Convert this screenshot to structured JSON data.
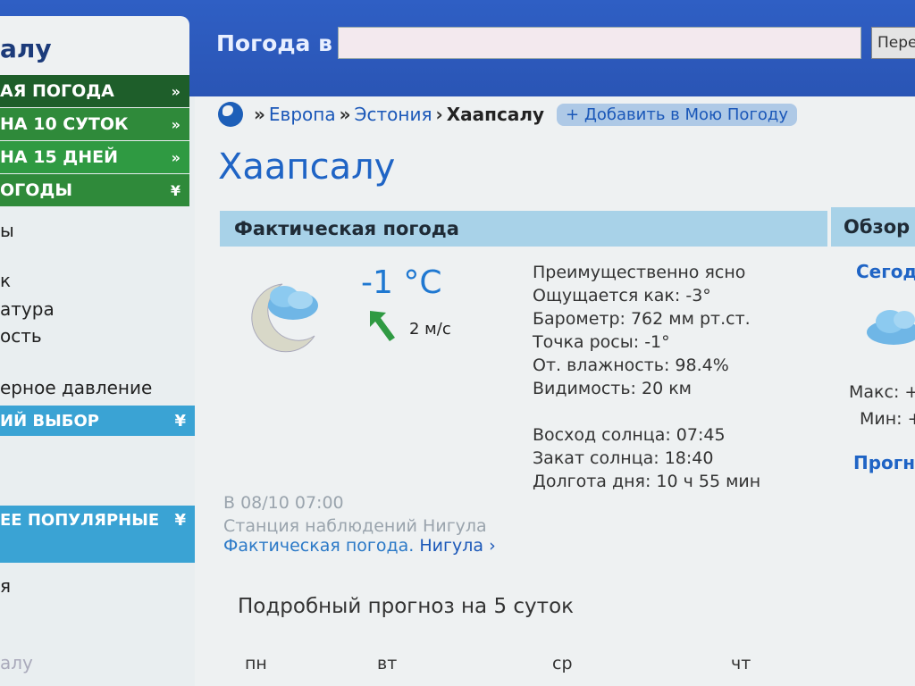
{
  "header": {
    "site_name": "алу",
    "search_label": "Погода в",
    "search_value": "",
    "search_button": "Пере"
  },
  "left_menu": {
    "green_items": [
      {
        "label": "АЯ ПОГОДА",
        "arrow": "»"
      },
      {
        "label": "НА 10 СУТОК",
        "arrow": "»"
      },
      {
        "label": "НА 15 ДНЕЙ",
        "arrow": "»"
      },
      {
        "label": "ОГОДЫ",
        "arrow": "¥"
      }
    ],
    "links": [
      "ы",
      "к",
      "атура",
      "ость",
      "ерное давление"
    ],
    "choice_bar": "ИЙ ВЫБОР",
    "popular_bar": "ЕЕ ПОПУЛЯРНЫЕ",
    "bottom_links": [
      "я",
      "алу"
    ]
  },
  "breadcrumb": {
    "europe": "Европа",
    "estonia": "Эстония",
    "current": "Хаапсалу",
    "sep1": "»",
    "sep2": "»",
    "sep3": "›",
    "lead": "»",
    "add_button": "+ Добавить в Мою Погоду"
  },
  "city_title": "Хаапсалу",
  "current": {
    "section_title": "Фактическая погода",
    "temperature": "-1 °C",
    "wind": "2 м/с",
    "details": [
      "Преимущественно ясно",
      "Ощущается как: -3°",
      "Барометр: 762 мм рт.ст.",
      "Точка росы: -1°",
      "От. влажность: 98.4%",
      "Видимость: 20 км"
    ],
    "sun": [
      "Восход солнца: 07:45",
      "Закат солнца: 18:40",
      "Долгота дня: 10 ч 55 мин"
    ],
    "observed_at": "В 08/10 07:00",
    "station": "Станция наблюдений Нигула",
    "obs_link_prefix": "Фактическая погода.",
    "obs_link_station": "Нигула ›"
  },
  "overview": {
    "section_title": "Обзор",
    "today": "Сегод",
    "max": "Макс: +",
    "min": "Мин: +",
    "forecast_link": "Прогно"
  },
  "forecast": {
    "title": "Подробный прогноз на 5 суток",
    "days": [
      "пн",
      "вт",
      "ср",
      "чт"
    ]
  },
  "colors": {
    "header_blue": "#2f5fc4",
    "menu_green": "#2f8a3a",
    "section_blue": "#a8d2e8",
    "link_blue": "#1a57b8"
  }
}
